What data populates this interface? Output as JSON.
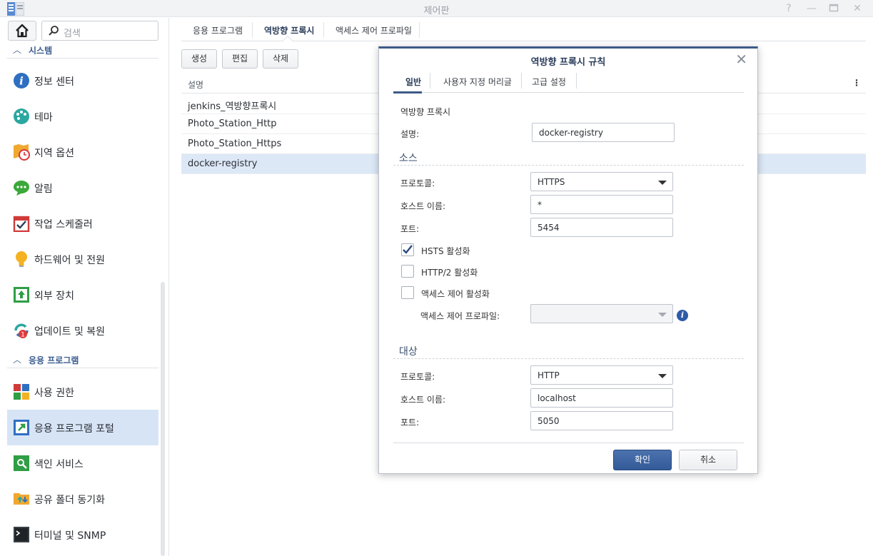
{
  "window": {
    "title": "제어판",
    "controls": [
      "help-icon",
      "minimize-icon",
      "maximize-icon",
      "close-icon"
    ]
  },
  "sidebar": {
    "search_placeholder": "검색",
    "sections": [
      {
        "label": "시스템"
      },
      {
        "label": "응용 프로그램"
      }
    ],
    "items": [
      {
        "label": "정보 센터",
        "icon": "info-icon"
      },
      {
        "label": "테마",
        "icon": "palette-icon"
      },
      {
        "label": "지역 옵션",
        "icon": "map-clock-icon"
      },
      {
        "label": "알림",
        "icon": "chat-bubble-icon"
      },
      {
        "label": "작업 스케줄러",
        "icon": "calendar-check-icon"
      },
      {
        "label": "하드웨어 및 전원",
        "icon": "lightbulb-icon"
      },
      {
        "label": "외부 장치",
        "icon": "upload-device-icon"
      },
      {
        "label": "업데이트 및 복원",
        "icon": "update-icon",
        "badge": "1"
      },
      {
        "label": "사용 권한",
        "icon": "permissions-icon"
      },
      {
        "label": "응용 프로그램 포털",
        "icon": "app-portal-icon"
      },
      {
        "label": "색인 서비스",
        "icon": "index-search-icon"
      },
      {
        "label": "공유 폴더 동기화",
        "icon": "folder-sync-icon"
      },
      {
        "label": "터미널 및 SNMP",
        "icon": "terminal-icon"
      }
    ]
  },
  "main": {
    "tabs": [
      {
        "label": "응용 프로그램"
      },
      {
        "label": "역방향 프록시"
      },
      {
        "label": "액세스 제어 프로파일"
      }
    ],
    "toolbar": {
      "create": "생성",
      "edit": "편집",
      "delete": "삭제"
    },
    "table": {
      "column": "설명",
      "menu": "⋮",
      "rows": [
        {
          "name": "jenkins_역방향프록시"
        },
        {
          "name": "Photo_Station_Http"
        },
        {
          "name": "Photo_Station_Https"
        },
        {
          "name": "docker-registry"
        }
      ]
    }
  },
  "dialog": {
    "title": "역방향 프록시 규칙",
    "tabs": [
      {
        "label": "일반"
      },
      {
        "label": "사용자 지정 머리글"
      },
      {
        "label": "고급 설정"
      }
    ],
    "section_title": "역방향 프록시",
    "description_label": "설명:",
    "description_value": "docker-registry",
    "source": {
      "heading": "소스",
      "protocol_label": "프로토콜:",
      "protocol_value": "HTTPS",
      "hostname_label": "호스트 이름:",
      "hostname_value": "*",
      "port_label": "포트:",
      "port_value": "5454",
      "hsts_label": "HSTS 활성화",
      "hsts_checked": true,
      "http2_label": "HTTP/2 활성화",
      "http2_checked": false,
      "access_control_label": "액세스 제어 활성화",
      "access_control_checked": false,
      "access_profile_label": "액세스 제어 프로파일:",
      "access_profile_value": ""
    },
    "destination": {
      "heading": "대상",
      "protocol_label": "프로토콜:",
      "protocol_value": "HTTP",
      "hostname_label": "호스트 이름:",
      "hostname_value": "localhost",
      "port_label": "포트:",
      "port_value": "5050"
    },
    "ok": "확인",
    "cancel": "취소"
  },
  "colors": {
    "accent": "#3c5a86",
    "primary_button": "#3d659f",
    "selected_row": "#dde8f7",
    "active_nav": "#d7e4f6",
    "badge": "#e03b3b"
  }
}
